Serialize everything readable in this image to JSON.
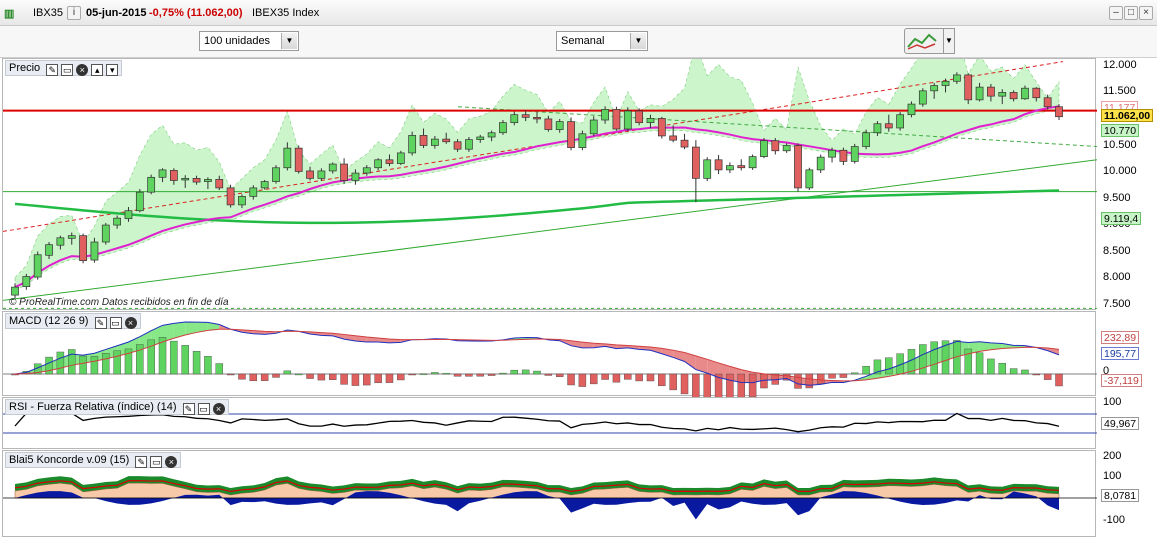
{
  "titlebar": {
    "symbol": "IBX35",
    "date": "05-jun-2015",
    "change": "-0,75% (11.062,00)",
    "name": "IBEX35 Index",
    "change_color": "#cc0000"
  },
  "toolbar": {
    "units_value": "100 unidades",
    "period_value": "Semanal"
  },
  "panels": {
    "price": {
      "title": "Precio",
      "watermark": "© ProRealTime.com  Datos recibidos en fin de día",
      "ticks": [
        "12.000",
        "11.500",
        "11.000",
        "10.500",
        "10.000",
        "9.500",
        "9.000",
        "8.500",
        "8.000",
        "7.500"
      ],
      "badges": {
        "resistance": "11.177",
        "last": "11.062,00",
        "lower": "10.770",
        "ma": "9.119,4"
      }
    },
    "macd": {
      "title": "MACD (12 26 9)",
      "badges": {
        "macd": "232,89",
        "signal": "195,77",
        "hist": "-37,119"
      },
      "zero_tick": "0"
    },
    "rsi": {
      "title": "RSI - Fuerza Relativa (índice) (14)",
      "ticks": [
        "100"
      ],
      "badges": {
        "value": "49,967"
      }
    },
    "koncorde": {
      "title": "Blai5 Koncorde v.09 (15)",
      "ticks": [
        "200",
        "100",
        "-100"
      ],
      "badges": {
        "value": "8,0781"
      }
    }
  },
  "colors": {
    "up": "#5fd35f",
    "down": "#e06060",
    "ma_magenta": "#e020d0",
    "ma_green": "#22bb44",
    "resistance": "#dd0000",
    "band_fill": "#ccf5cc"
  },
  "chart_data": {
    "type": "candlestick",
    "period": "weekly",
    "y_range": [
      7400,
      12150
    ],
    "ohlc": [
      [
        7700,
        7920,
        7640,
        7850
      ],
      [
        7860,
        8100,
        7800,
        8050
      ],
      [
        8040,
        8520,
        7990,
        8460
      ],
      [
        8450,
        8700,
        8380,
        8650
      ],
      [
        8640,
        8820,
        8560,
        8780
      ],
      [
        8770,
        8880,
        8650,
        8820
      ],
      [
        8820,
        8860,
        8300,
        8350
      ],
      [
        8360,
        8780,
        8310,
        8700
      ],
      [
        8700,
        9060,
        8650,
        9020
      ],
      [
        9020,
        9200,
        8950,
        9150
      ],
      [
        9140,
        9360,
        9080,
        9290
      ],
      [
        9290,
        9700,
        9260,
        9640
      ],
      [
        9640,
        9970,
        9600,
        9920
      ],
      [
        9920,
        10090,
        9830,
        10060
      ],
      [
        10050,
        10090,
        9780,
        9860
      ],
      [
        9870,
        9960,
        9720,
        9900
      ],
      [
        9900,
        9950,
        9780,
        9830
      ],
      [
        9840,
        9920,
        9700,
        9880
      ],
      [
        9880,
        9950,
        9680,
        9720
      ],
      [
        9720,
        9780,
        9350,
        9400
      ],
      [
        9400,
        9600,
        9340,
        9560
      ],
      [
        9560,
        9770,
        9500,
        9720
      ],
      [
        9720,
        9870,
        9690,
        9840
      ],
      [
        9840,
        10150,
        9800,
        10100
      ],
      [
        10100,
        10580,
        10050,
        10470
      ],
      [
        10470,
        10520,
        9990,
        10030
      ],
      [
        10040,
        10120,
        9860,
        9900
      ],
      [
        9900,
        10090,
        9850,
        10040
      ],
      [
        10040,
        10200,
        9990,
        10170
      ],
      [
        10170,
        10280,
        9800,
        9860
      ],
      [
        9860,
        10070,
        9780,
        10000
      ],
      [
        10000,
        10150,
        9950,
        10100
      ],
      [
        10100,
        10280,
        10050,
        10250
      ],
      [
        10250,
        10350,
        10130,
        10180
      ],
      [
        10180,
        10420,
        10150,
        10380
      ],
      [
        10380,
        10780,
        10330,
        10710
      ],
      [
        10710,
        10840,
        10470,
        10520
      ],
      [
        10520,
        10700,
        10460,
        10640
      ],
      [
        10640,
        10760,
        10550,
        10590
      ],
      [
        10590,
        10640,
        10400,
        10450
      ],
      [
        10450,
        10680,
        10400,
        10630
      ],
      [
        10630,
        10720,
        10570,
        10680
      ],
      [
        10680,
        10800,
        10600,
        10760
      ],
      [
        10760,
        11000,
        10720,
        10950
      ],
      [
        10950,
        11160,
        10900,
        11100
      ],
      [
        11100,
        11180,
        10980,
        11050
      ],
      [
        11050,
        11150,
        10940,
        11020
      ],
      [
        11020,
        11080,
        10780,
        10820
      ],
      [
        10820,
        11020,
        10760,
        10970
      ],
      [
        10970,
        11050,
        10430,
        10480
      ],
      [
        10480,
        10800,
        10430,
        10740
      ],
      [
        10740,
        11070,
        10700,
        11000
      ],
      [
        11000,
        11260,
        10930,
        11200
      ],
      [
        11200,
        11250,
        10800,
        10830
      ],
      [
        10830,
        11240,
        10790,
        11170
      ],
      [
        11170,
        11220,
        10900,
        10950
      ],
      [
        10950,
        11100,
        10840,
        11030
      ],
      [
        11030,
        11060,
        10650,
        10700
      ],
      [
        10700,
        10900,
        10580,
        10620
      ],
      [
        10620,
        10740,
        10450,
        10490
      ],
      [
        10490,
        10620,
        9450,
        9900
      ],
      [
        9900,
        10300,
        9850,
        10250
      ],
      [
        10250,
        10340,
        9980,
        10060
      ],
      [
        10060,
        10200,
        10000,
        10140
      ],
      [
        10140,
        10260,
        10050,
        10100
      ],
      [
        10100,
        10350,
        10060,
        10310
      ],
      [
        10310,
        10660,
        10280,
        10610
      ],
      [
        10610,
        10660,
        10350,
        10420
      ],
      [
        10420,
        10560,
        10380,
        10520
      ],
      [
        10520,
        10560,
        9650,
        9720
      ],
      [
        9720,
        10100,
        9680,
        10060
      ],
      [
        10060,
        10350,
        10000,
        10300
      ],
      [
        10300,
        10480,
        10200,
        10430
      ],
      [
        10430,
        10480,
        10150,
        10220
      ],
      [
        10220,
        10550,
        10180,
        10500
      ],
      [
        10500,
        10820,
        10450,
        10760
      ],
      [
        10760,
        10980,
        10700,
        10930
      ],
      [
        10930,
        11100,
        10780,
        10850
      ],
      [
        10850,
        11150,
        10800,
        11100
      ],
      [
        11100,
        11350,
        11050,
        11300
      ],
      [
        11300,
        11600,
        11250,
        11550
      ],
      [
        11550,
        11700,
        11400,
        11650
      ],
      [
        11650,
        11780,
        11520,
        11730
      ],
      [
        11730,
        11900,
        11680,
        11850
      ],
      [
        11850,
        11880,
        11300,
        11380
      ],
      [
        11380,
        11700,
        11350,
        11620
      ],
      [
        11620,
        11680,
        11350,
        11450
      ],
      [
        11450,
        11580,
        11300,
        11520
      ],
      [
        11520,
        11560,
        11350,
        11400
      ],
      [
        11400,
        11650,
        11380,
        11600
      ],
      [
        11600,
        11620,
        11350,
        11420
      ],
      [
        11420,
        11480,
        11200,
        11250
      ],
      [
        11250,
        11300,
        11000,
        11062
      ]
    ]
  }
}
